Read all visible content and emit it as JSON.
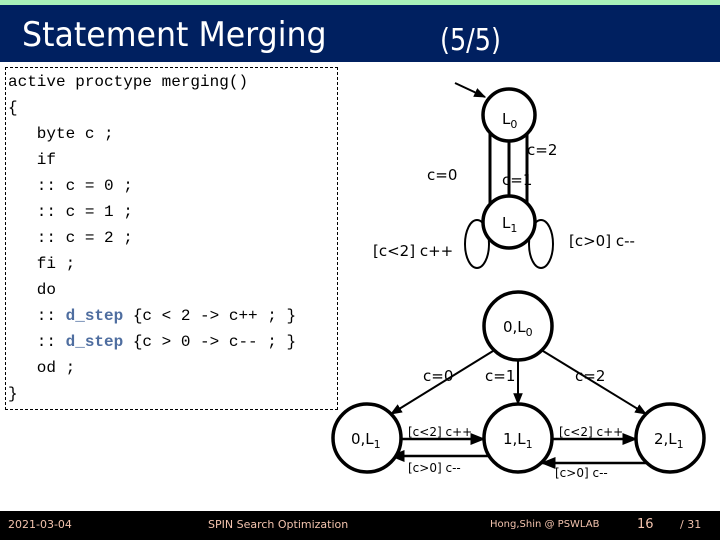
{
  "header": {
    "title": "Statement Merging",
    "page_indicator": "(5/5)"
  },
  "code": {
    "lines": [
      {
        "pre": "active proctype merging()",
        "kw": "",
        "post": ""
      },
      {
        "pre": "{",
        "kw": "",
        "post": ""
      },
      {
        "pre": "   byte c ;",
        "kw": "",
        "post": ""
      },
      {
        "pre": "   if",
        "kw": "",
        "post": ""
      },
      {
        "pre": "   :: c = 0 ;",
        "kw": "",
        "post": ""
      },
      {
        "pre": "   :: c = 1 ;",
        "kw": "",
        "post": ""
      },
      {
        "pre": "   :: c = 2 ;",
        "kw": "",
        "post": ""
      },
      {
        "pre": "   fi ;",
        "kw": "",
        "post": ""
      },
      {
        "pre": "   do",
        "kw": "",
        "post": ""
      },
      {
        "pre": "   :: ",
        "kw": "d_step",
        "post": " {c < 2 -> c++ ; }"
      },
      {
        "pre": "   :: ",
        "kw": "d_step",
        "post": " {c > 0 -> c-- ; }"
      },
      {
        "pre": "   od ;",
        "kw": "",
        "post": ""
      },
      {
        "pre": "}",
        "kw": "",
        "post": ""
      }
    ]
  },
  "automaton": {
    "states": [
      {
        "id": "L0",
        "name": "L",
        "sub": "0"
      },
      {
        "id": "L1",
        "name": "L",
        "sub": "1"
      }
    ],
    "transitions": [
      {
        "from": "L0",
        "to": "L1",
        "label": "c=0"
      },
      {
        "from": "L0",
        "to": "L1",
        "label": "c=1"
      },
      {
        "from": "L0",
        "to": "L1",
        "label": "c=2"
      },
      {
        "from": "L1",
        "to": "L1",
        "label": "[c<2] c++"
      },
      {
        "from": "L1",
        "to": "L1",
        "label": "[c>0] c--"
      }
    ]
  },
  "state_space": {
    "states": [
      {
        "id": "0L0",
        "prefix": "0,L",
        "sub": "0"
      },
      {
        "id": "0L1",
        "prefix": "0,L",
        "sub": "1"
      },
      {
        "id": "1L1",
        "prefix": "1,L",
        "sub": "1"
      },
      {
        "id": "2L1",
        "prefix": "2,L",
        "sub": "1"
      }
    ],
    "transitions": [
      {
        "from": "0L0",
        "to": "0L1",
        "label": "c=0"
      },
      {
        "from": "0L0",
        "to": "1L1",
        "label": "c=1"
      },
      {
        "from": "0L0",
        "to": "2L1",
        "label": "c=2"
      },
      {
        "from": "0L1",
        "to": "1L1",
        "label": "[c<2] c++"
      },
      {
        "from": "1L1",
        "to": "0L1",
        "label": "[c>0] c--"
      },
      {
        "from": "1L1",
        "to": "2L1",
        "label": "[c<2] c++"
      },
      {
        "from": "2L1",
        "to": "1L1",
        "label": "[c>0] c--"
      }
    ]
  },
  "footer": {
    "date": "2021-03-04",
    "topic": "SPIN Search Optimization",
    "author": "Hong,Shin @ PSWLAB",
    "page": "16",
    "total": "/ 31"
  },
  "colors": {
    "title_bar": "#002060",
    "top_strip": "#a9f1b9",
    "keyword": "#4f6ea0",
    "footer_text": "#f3c3ae"
  }
}
